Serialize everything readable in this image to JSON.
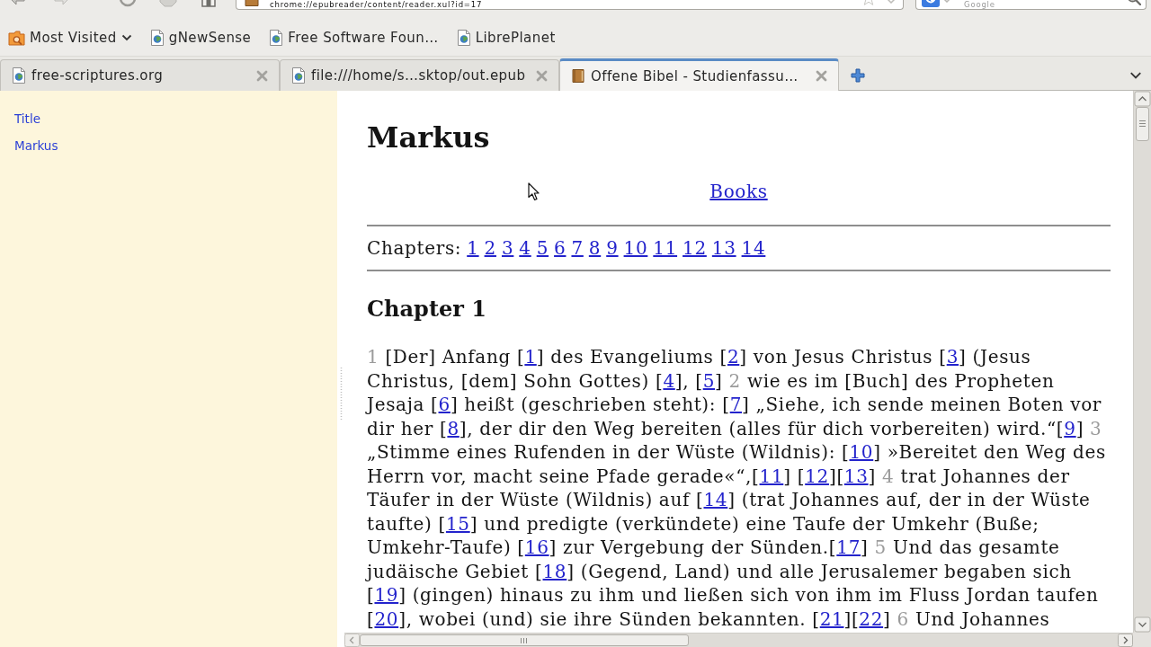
{
  "toolbar": {
    "url": "chrome://epubreader/content/reader.xul?id=17",
    "search": {
      "placeholder": "Google"
    }
  },
  "bookmarks": [
    {
      "label": "Most Visited",
      "kind": "folder"
    },
    {
      "label": "gNewSense",
      "kind": "page"
    },
    {
      "label": "Free Software Foun…",
      "kind": "page"
    },
    {
      "label": "LibrePlanet",
      "kind": "page"
    }
  ],
  "tabs": [
    {
      "title": "free-scriptures.org",
      "kind": "page",
      "selected": false
    },
    {
      "title": "file:///home/s…sktop/out.epub",
      "kind": "page",
      "selected": false
    },
    {
      "title": "Offene Bibel - Studienfassu…",
      "kind": "book",
      "selected": true
    }
  ],
  "sidebar": {
    "items": [
      {
        "label": "Title"
      },
      {
        "label": "Markus"
      }
    ]
  },
  "document": {
    "title": "Markus",
    "books_link": "Books",
    "chapters": {
      "label": "Chapters:",
      "links": [
        "1",
        "2",
        "3",
        "4",
        "5",
        "6",
        "7",
        "8",
        "9",
        "10",
        "11",
        "12",
        "13",
        "14"
      ]
    },
    "chapter_heading": "Chapter 1",
    "paragraph": [
      {
        "kind": "verse",
        "text": "1"
      },
      {
        "kind": "text",
        "text": " [Der] Anfang ["
      },
      {
        "kind": "note",
        "text": "1"
      },
      {
        "kind": "text",
        "text": "] des Evangeliums ["
      },
      {
        "kind": "note",
        "text": "2"
      },
      {
        "kind": "text",
        "text": "] von Jesus Christus ["
      },
      {
        "kind": "note",
        "text": "3"
      },
      {
        "kind": "text",
        "text": "] (Jesus Christus, [dem] Sohn Gottes) ["
      },
      {
        "kind": "note",
        "text": "4"
      },
      {
        "kind": "text",
        "text": "], ["
      },
      {
        "kind": "note",
        "text": "5"
      },
      {
        "kind": "text",
        "text": "] "
      },
      {
        "kind": "verse",
        "text": "2"
      },
      {
        "kind": "text",
        "text": " wie es im [Buch] des Propheten Jesaja ["
      },
      {
        "kind": "note",
        "text": "6"
      },
      {
        "kind": "text",
        "text": "] heißt (geschrieben steht): ["
      },
      {
        "kind": "note",
        "text": "7"
      },
      {
        "kind": "text",
        "text": "] „Siehe, ich sende meinen Boten vor dir her ["
      },
      {
        "kind": "note",
        "text": "8"
      },
      {
        "kind": "text",
        "text": "], der dir den Weg bereiten (alles für dich vorbereiten) wird.“["
      },
      {
        "kind": "note",
        "text": "9"
      },
      {
        "kind": "text",
        "text": "] "
      },
      {
        "kind": "verse",
        "text": "3"
      },
      {
        "kind": "text",
        "text": " „Stimme eines Rufenden in der Wüste (Wildnis): ["
      },
      {
        "kind": "note",
        "text": "10"
      },
      {
        "kind": "text",
        "text": "] »Bereitet den Weg des Herrn vor, macht seine Pfade gerade«“,["
      },
      {
        "kind": "note",
        "text": "11"
      },
      {
        "kind": "text",
        "text": "] ["
      },
      {
        "kind": "note",
        "text": "12"
      },
      {
        "kind": "text",
        "text": "]["
      },
      {
        "kind": "note",
        "text": "13"
      },
      {
        "kind": "text",
        "text": "] "
      },
      {
        "kind": "verse",
        "text": "4"
      },
      {
        "kind": "text",
        "text": " trat Johannes der Täufer in der Wüste (Wildnis) auf ["
      },
      {
        "kind": "note",
        "text": "14"
      },
      {
        "kind": "text",
        "text": "] (trat Johannes auf, der in der Wüste taufte) ["
      },
      {
        "kind": "note",
        "text": "15"
      },
      {
        "kind": "text",
        "text": "] und predigte (verkündete) eine Taufe der Umkehr (Buße; Umkehr-Taufe) ["
      },
      {
        "kind": "note",
        "text": "16"
      },
      {
        "kind": "text",
        "text": "] zur Vergebung der Sünden.["
      },
      {
        "kind": "note",
        "text": "17"
      },
      {
        "kind": "text",
        "text": "] "
      },
      {
        "kind": "verse",
        "text": "5"
      },
      {
        "kind": "text",
        "text": " Und das gesamte judäische Gebiet ["
      },
      {
        "kind": "note",
        "text": "18"
      },
      {
        "kind": "text",
        "text": "] (Gegend, Land) und alle Jerusalemer begaben sich ["
      },
      {
        "kind": "note",
        "text": "19"
      },
      {
        "kind": "text",
        "text": "] (gingen) hinaus zu ihm und ließen sich von ihm im Fluss Jordan taufen ["
      },
      {
        "kind": "note",
        "text": "20"
      },
      {
        "kind": "text",
        "text": "], wobei (und) sie ihre Sünden bekannten. ["
      },
      {
        "kind": "note",
        "text": "21"
      },
      {
        "kind": "text",
        "text": "]["
      },
      {
        "kind": "note",
        "text": "22"
      },
      {
        "kind": "text",
        "text": "] "
      },
      {
        "kind": "verse",
        "text": "6"
      },
      {
        "kind": "text",
        "text": " Und Johannes"
      }
    ]
  }
}
